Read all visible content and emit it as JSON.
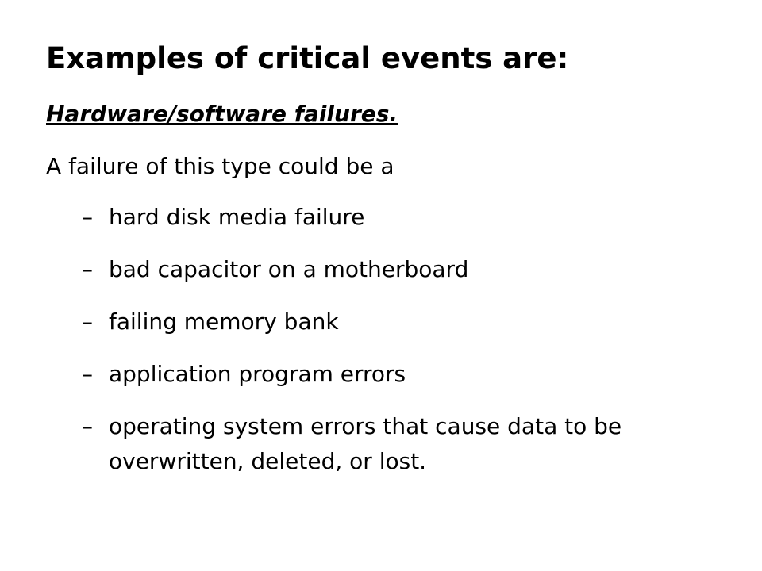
{
  "slide": {
    "title": "Examples of critical events are:",
    "subheading": "Hardware/software failures.",
    "intro": "A failure of this type could be a",
    "bullet_marker": "–",
    "bullets": [
      "hard disk media failure",
      "bad capacitor on a motherboard",
      "failing memory bank",
      "application program errors",
      "operating system errors that cause data to be overwritten, deleted, or lost."
    ]
  }
}
